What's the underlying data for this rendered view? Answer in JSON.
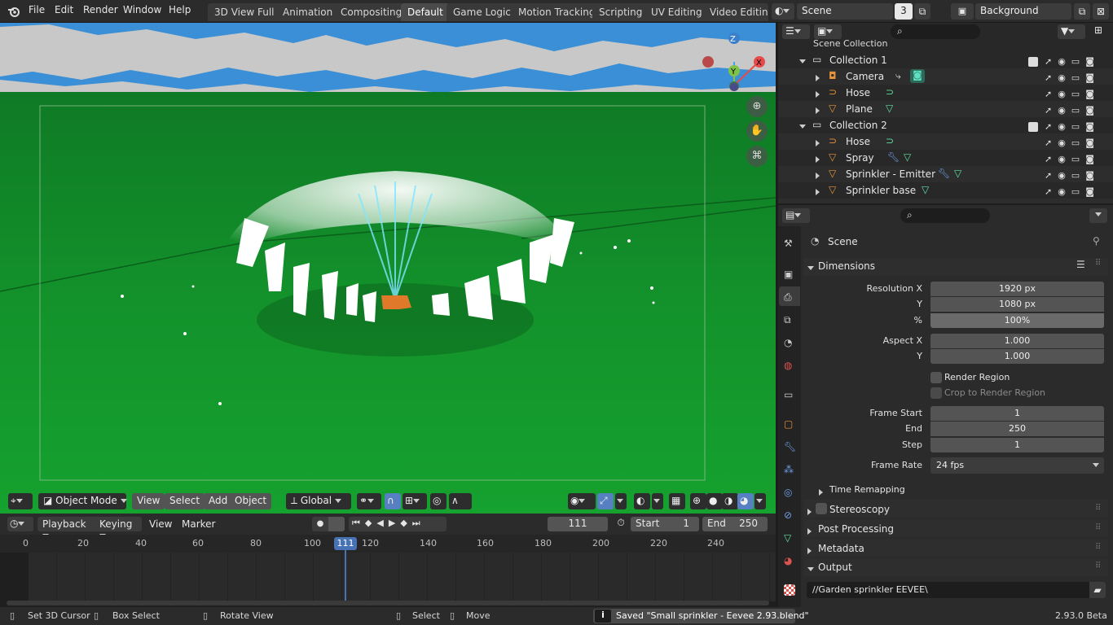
{
  "topbar": {
    "menus": [
      "File",
      "Edit",
      "Render",
      "Window",
      "Help"
    ],
    "workspaces": [
      "3D View Full",
      "Animation",
      "Compositing",
      "Default",
      "Game Logic",
      "Motion Tracking",
      "Scripting",
      "UV Editing",
      "Video Editing"
    ],
    "active_workspace": "Default",
    "scene_name": "Scene",
    "scene_users": "3",
    "view_layer": "Background"
  },
  "viewport": {
    "mode": "Object Mode",
    "menus": [
      "View",
      "Select",
      "Add",
      "Object"
    ],
    "orientation": "Global",
    "gizmo_axes": {
      "x": "X",
      "y": "Y",
      "z": "Z"
    }
  },
  "timeline": {
    "menus": [
      "Playback",
      "Keying",
      "View",
      "Marker"
    ],
    "current_frame": "111",
    "start_label": "Start",
    "start": "1",
    "end_label": "End",
    "end": "250",
    "ticks": [
      "0",
      "20",
      "40",
      "60",
      "80",
      "100",
      "120",
      "140",
      "160",
      "180",
      "200",
      "220",
      "240"
    ]
  },
  "outliner": {
    "header_partial": "Scene Collection",
    "rows": [
      {
        "label": "Collection 1",
        "indent": 1,
        "type": "collection"
      },
      {
        "label": "Camera",
        "indent": 2,
        "type": "camera"
      },
      {
        "label": "Hose",
        "indent": 2,
        "type": "curve"
      },
      {
        "label": "Plane",
        "indent": 2,
        "type": "mesh"
      },
      {
        "label": "Collection 2",
        "indent": 1,
        "type": "collection"
      },
      {
        "label": "Hose",
        "indent": 2,
        "type": "curve"
      },
      {
        "label": "Spray",
        "indent": 2,
        "type": "mesh"
      },
      {
        "label": "Sprinkler - Emitter",
        "indent": 2,
        "type": "mesh"
      },
      {
        "label": "Sprinkler base",
        "indent": 2,
        "type": "mesh"
      }
    ]
  },
  "properties": {
    "context": "Scene",
    "dimensions_title": "Dimensions",
    "resolution_x_label": "Resolution X",
    "resolution_x": "1920 px",
    "y_label": "Y",
    "resolution_y": "1080 px",
    "percent_label": "%",
    "percent": "100%",
    "aspect_x_label": "Aspect X",
    "aspect_x": "1.000",
    "aspect_y": "1.000",
    "render_region": "Render Region",
    "crop_region": "Crop to Render Region",
    "frame_start_label": "Frame Start",
    "frame_start": "1",
    "end_label": "End",
    "frame_end": "250",
    "step_label": "Step",
    "step": "1",
    "frame_rate_label": "Frame Rate",
    "frame_rate": "24 fps",
    "time_remapping": "Time Remapping",
    "stereoscopy": "Stereoscopy",
    "post_processing": "Post Processing",
    "metadata": "Metadata",
    "output": "Output",
    "output_path": "//Garden sprinkler  EEVEE\\"
  },
  "status": {
    "set_cursor": "Set 3D Cursor",
    "box_select": "Box Select",
    "rotate_view": "Rotate View",
    "select": "Select",
    "move": "Move",
    "message": "Saved \"Small sprinkler - Eevee 2.93.blend\"",
    "version": "2.93.0 Beta"
  }
}
